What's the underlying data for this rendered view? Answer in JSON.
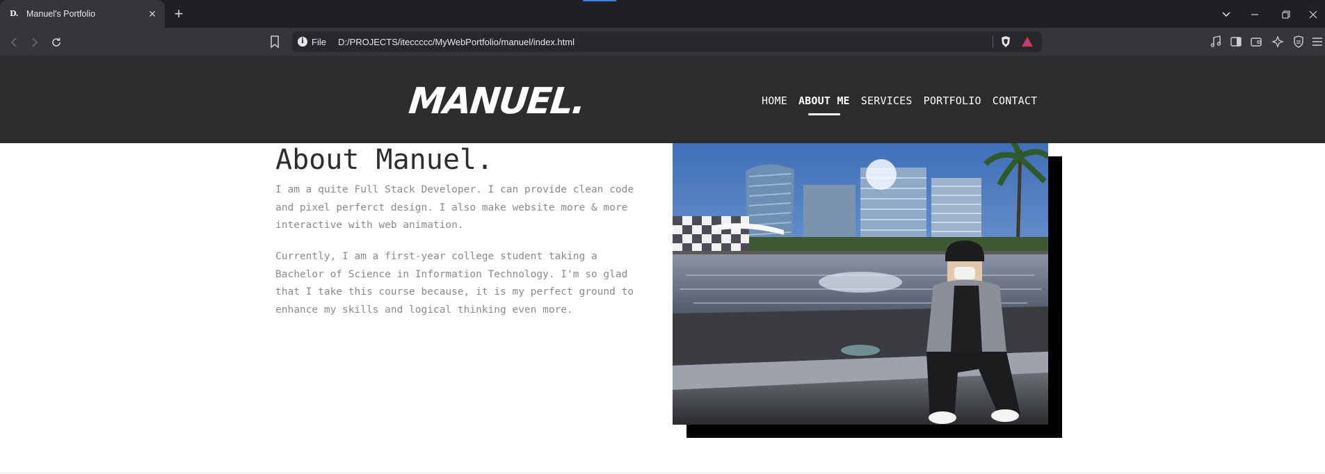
{
  "browser": {
    "tab": {
      "favicon": "D.",
      "title": "Manuel's Portfolio",
      "close_icon": "close-icon"
    },
    "new_tab": "+",
    "window_controls": {
      "tab_search": "chevron-down-icon",
      "minimize": "minimize-icon",
      "restore": "restore-icon",
      "close": "close-icon"
    },
    "toolbar": {
      "scheme_label": "File",
      "url": "D:/PROJECTS/iteccccc/MyWebPortfolio/manuel/index.html"
    },
    "colors": {
      "tab_bar": "#1f1f24",
      "toolbar": "#35363b",
      "omnibox": "#27282c",
      "accent": "#3d7fe6"
    }
  },
  "site": {
    "logo": "MANUEL.",
    "nav": [
      {
        "label": "HOME",
        "active": false
      },
      {
        "label": "ABOUT ME",
        "active": true
      },
      {
        "label": "SERVICES",
        "active": false
      },
      {
        "label": "PORTFOLIO",
        "active": false
      },
      {
        "label": "CONTACT",
        "active": false
      }
    ],
    "colors": {
      "header_bg": "#2d2d2d",
      "text_muted": "#8a8a8a",
      "heading": "#2d2d2d"
    }
  },
  "about": {
    "title": "About Manuel.",
    "paragraph_1": "I am a quite Full Stack Developer. I can provide clean code and pixel perferct design. I also make website more & more interactive with web animation.",
    "paragraph_2": "Currently, I am a first-year college student taking a Bachelor of Science in Information Technology. I'm so glad that I take this course because, it is my perfect ground to enhance my skills and logical thinking even more."
  }
}
